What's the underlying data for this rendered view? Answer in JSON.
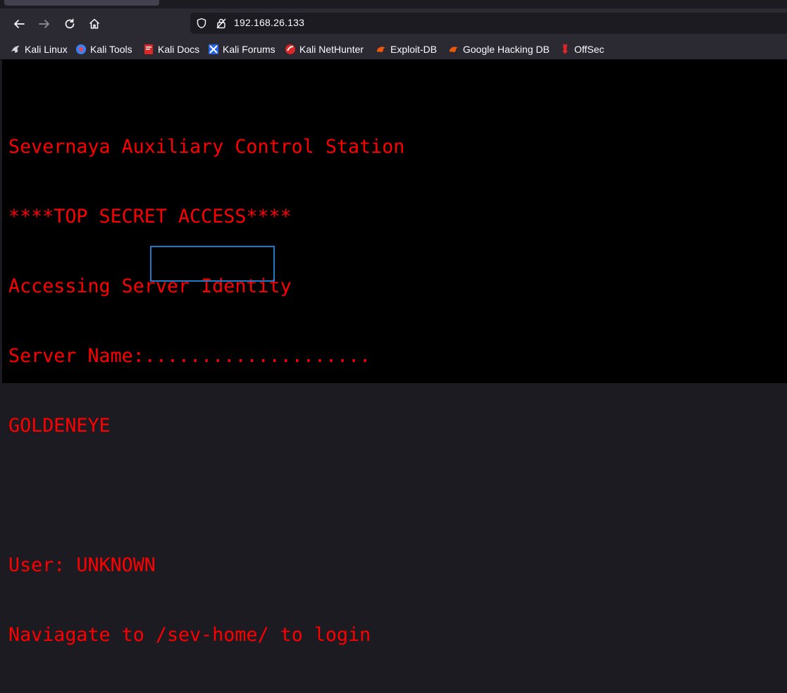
{
  "browser": {
    "address": "192.168.26.133",
    "colors": {
      "chrome": "#2b2a33",
      "urlbar": "#1c1b22",
      "text": "#fbfbfe"
    }
  },
  "bookmarks": [
    {
      "label": "Kali Linux",
      "icon": "kali-dragon-icon"
    },
    {
      "label": "Kali Tools",
      "icon": "kali-tools-icon"
    },
    {
      "label": "Kali Docs",
      "icon": "kali-docs-icon"
    },
    {
      "label": "Kali Forums",
      "icon": "kali-forums-icon"
    },
    {
      "label": "Kali NetHunter",
      "icon": "kali-nethunter-icon"
    },
    {
      "label": "Exploit-DB",
      "icon": "exploit-db-icon"
    },
    {
      "label": "Google Hacking DB",
      "icon": "ghdb-icon"
    },
    {
      "label": "OffSec",
      "icon": "offsec-icon"
    }
  ],
  "page": {
    "text_color": "#ff0000",
    "background": "#000000",
    "line1": "Severnaya Auxiliary Control Station",
    "line2": "****TOP SECRET ACCESS****",
    "line3": "Accessing Server Identity",
    "line4": "Server Name:....................",
    "line5": "GOLDENEYE",
    "line6": "",
    "line7": "User: UNKNOWN",
    "line8_prefix": "Naviagate to ",
    "line8_path": "/sev-home/",
    "line8_suffix": " to login",
    "highlight_color": "#1e7ac8"
  }
}
